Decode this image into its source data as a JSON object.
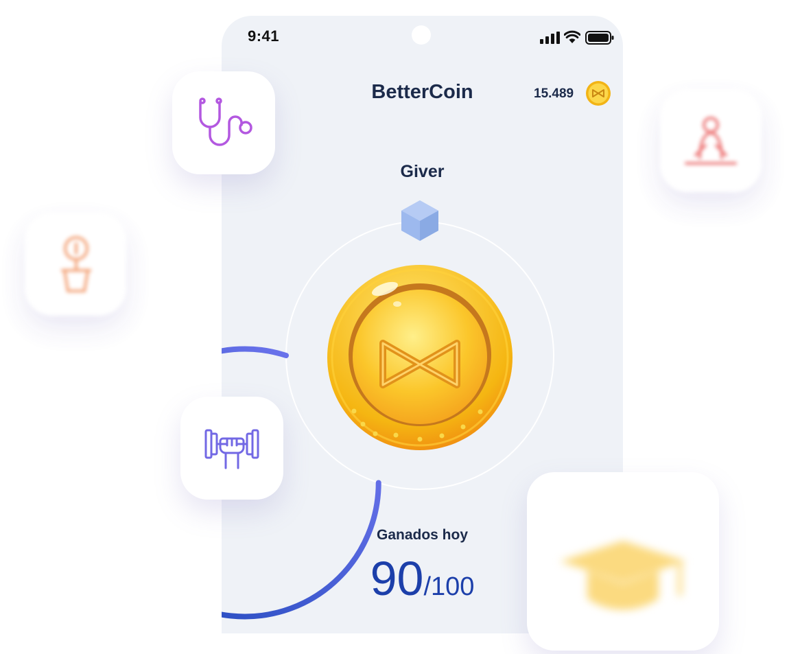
{
  "status_bar": {
    "time": "9:41"
  },
  "header": {
    "title": "BetterCoin",
    "balance": "15.489"
  },
  "level": {
    "name": "Giver",
    "progress_fraction": 0.8
  },
  "daily": {
    "label": "Ganados hoy",
    "earned": "90",
    "goal": "/100"
  },
  "floating_icons": [
    "stethoscope-icon",
    "dumbbell-icon",
    "piggy-plant-icon",
    "meditation-icon",
    "graduation-cap-icon"
  ],
  "colors": {
    "accent_start": "#1a45b8",
    "accent_end": "#7b7cf6",
    "text_dark": "#1b2a4a",
    "coin_gold": "#f7c21a",
    "phone_bg": "#eff2f7"
  }
}
